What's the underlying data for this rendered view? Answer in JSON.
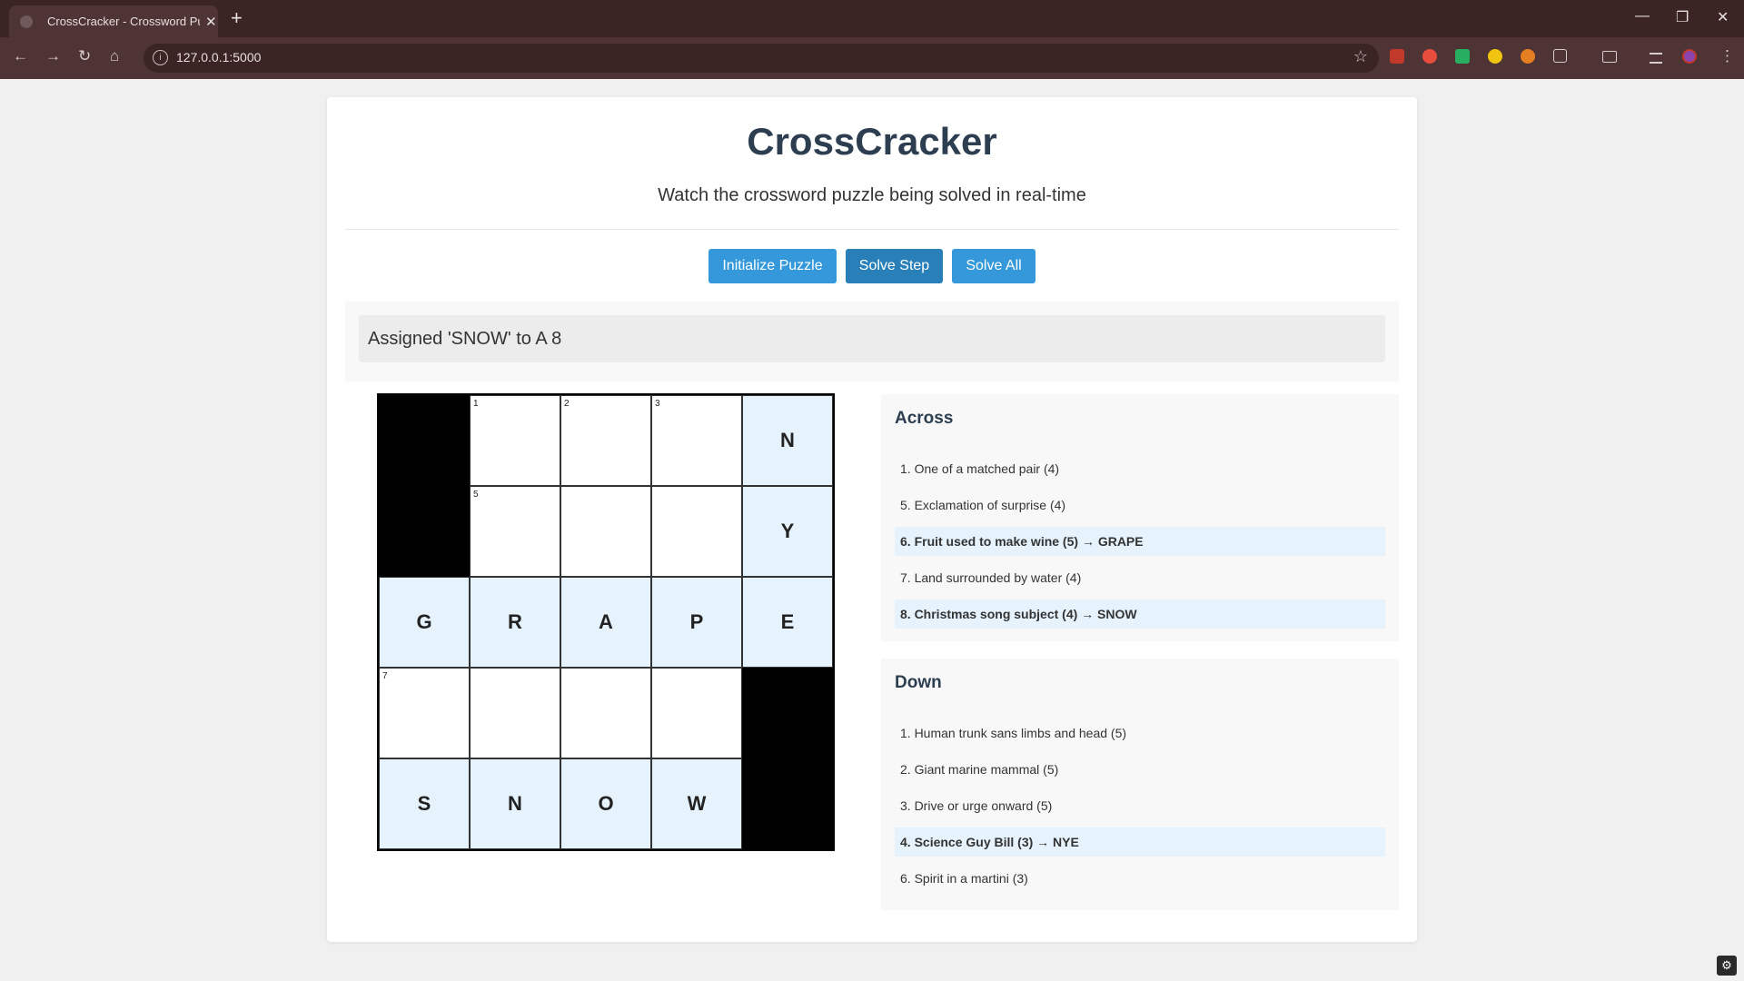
{
  "browser": {
    "tab_title": "CrossCracker - Crossword Puzzle",
    "url": "127.0.0.1:5000",
    "new_tab": "+",
    "close_tab": "✕"
  },
  "header": {
    "title": "CrossCracker",
    "subtitle": "Watch the crossword puzzle being solved in real-time"
  },
  "controls": {
    "initialize": "Initialize Puzzle",
    "solve_step": "Solve Step",
    "solve_all": "Solve All"
  },
  "status": {
    "message": "Assigned 'SNOW' to A 8"
  },
  "grid": {
    "rows": [
      [
        {
          "black": true
        },
        {
          "num": "1",
          "letter": ""
        },
        {
          "num": "2",
          "letter": ""
        },
        {
          "num": "3",
          "letter": ""
        },
        {
          "letter": "N",
          "filled": true
        }
      ],
      [
        {
          "black": true
        },
        {
          "num": "5",
          "letter": ""
        },
        {
          "letter": ""
        },
        {
          "letter": ""
        },
        {
          "letter": "Y",
          "filled": true
        }
      ],
      [
        {
          "letter": "G",
          "filled": true
        },
        {
          "letter": "R",
          "filled": true
        },
        {
          "letter": "A",
          "filled": true
        },
        {
          "letter": "P",
          "filled": true
        },
        {
          "letter": "E",
          "filled": true
        }
      ],
      [
        {
          "num": "7",
          "letter": ""
        },
        {
          "letter": ""
        },
        {
          "letter": ""
        },
        {
          "letter": ""
        },
        {
          "black": true
        }
      ],
      [
        {
          "letter": "S",
          "filled": true
        },
        {
          "letter": "N",
          "filled": true
        },
        {
          "letter": "O",
          "filled": true
        },
        {
          "letter": "W",
          "filled": true
        },
        {
          "black": true
        }
      ]
    ]
  },
  "across": {
    "heading": "Across",
    "clues": [
      {
        "text": "1. One of a matched pair (4)",
        "solved": false
      },
      {
        "text": "5. Exclamation of surprise (4)",
        "solved": false
      },
      {
        "text": "6. Fruit used to make wine (5) → GRAPE",
        "solved": true
      },
      {
        "text": "7. Land surrounded by water (4)",
        "solved": false
      },
      {
        "text": "8. Christmas song subject (4) → SNOW",
        "solved": true
      }
    ]
  },
  "down": {
    "heading": "Down",
    "clues": [
      {
        "text": "1. Human trunk sans limbs and head (5)",
        "solved": false
      },
      {
        "text": "2. Giant marine mammal (5)",
        "solved": false
      },
      {
        "text": "3. Drive or urge onward (5)",
        "solved": false
      },
      {
        "text": "4. Science Guy Bill (3) → NYE",
        "solved": true
      },
      {
        "text": "6. Spirit in a martini (3)",
        "solved": false
      }
    ]
  },
  "colors": {
    "button": "#3498db",
    "button_active": "#2980b9",
    "solved_highlight": "#e6f3fc",
    "title": "#2c3e50"
  }
}
